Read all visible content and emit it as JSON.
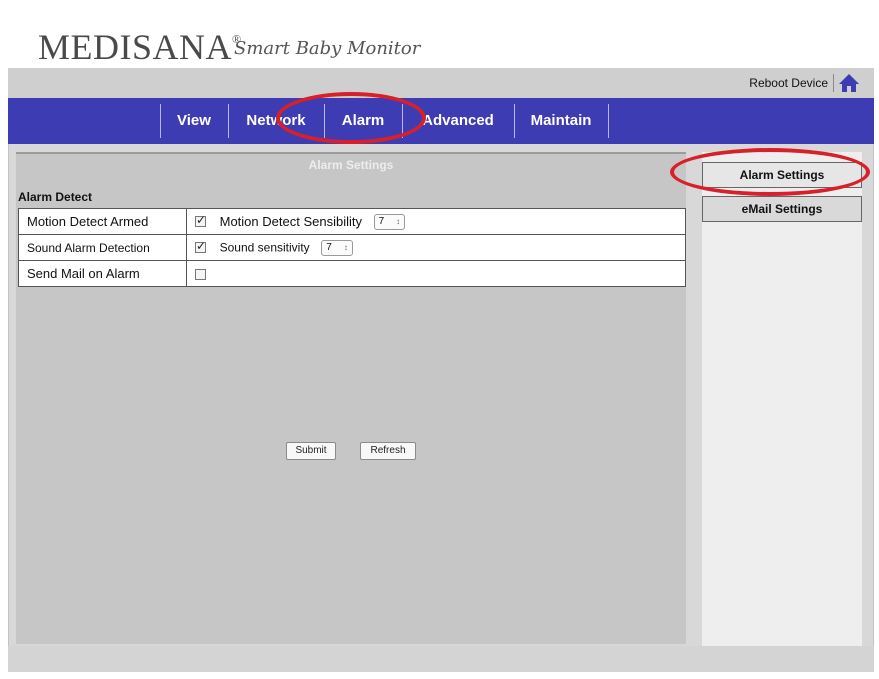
{
  "header": {
    "brand": "MEDISANA",
    "brand_mark": "®",
    "tagline": "Smart Baby Monitor"
  },
  "topbar": {
    "reboot_label": "Reboot Device",
    "home_icon": "home-icon"
  },
  "nav": {
    "items": [
      {
        "label": "View"
      },
      {
        "label": "Network"
      },
      {
        "label": "Alarm"
      },
      {
        "label": "Advanced"
      },
      {
        "label": "Maintain"
      }
    ],
    "active": "Alarm"
  },
  "main": {
    "section_title": "Alarm Settings",
    "group_title": "Alarm Detect",
    "rows": [
      {
        "label": "Motion Detect Armed",
        "checked": true,
        "option_label": "Motion Detect Sensibility",
        "option_value": "7"
      },
      {
        "label": "Sound Alarm Detection",
        "checked": true,
        "option_label": "Sound sensitivity",
        "option_value": "7"
      },
      {
        "label": "Send Mail on Alarm",
        "checked": false
      }
    ],
    "submit_label": "Submit",
    "refresh_label": "Refresh"
  },
  "sidebar": {
    "items": [
      {
        "label": "Alarm Settings"
      },
      {
        "label": "eMail Settings"
      }
    ]
  },
  "colors": {
    "nav_bg": "#3d3cb2",
    "annotation": "#d8202a"
  }
}
